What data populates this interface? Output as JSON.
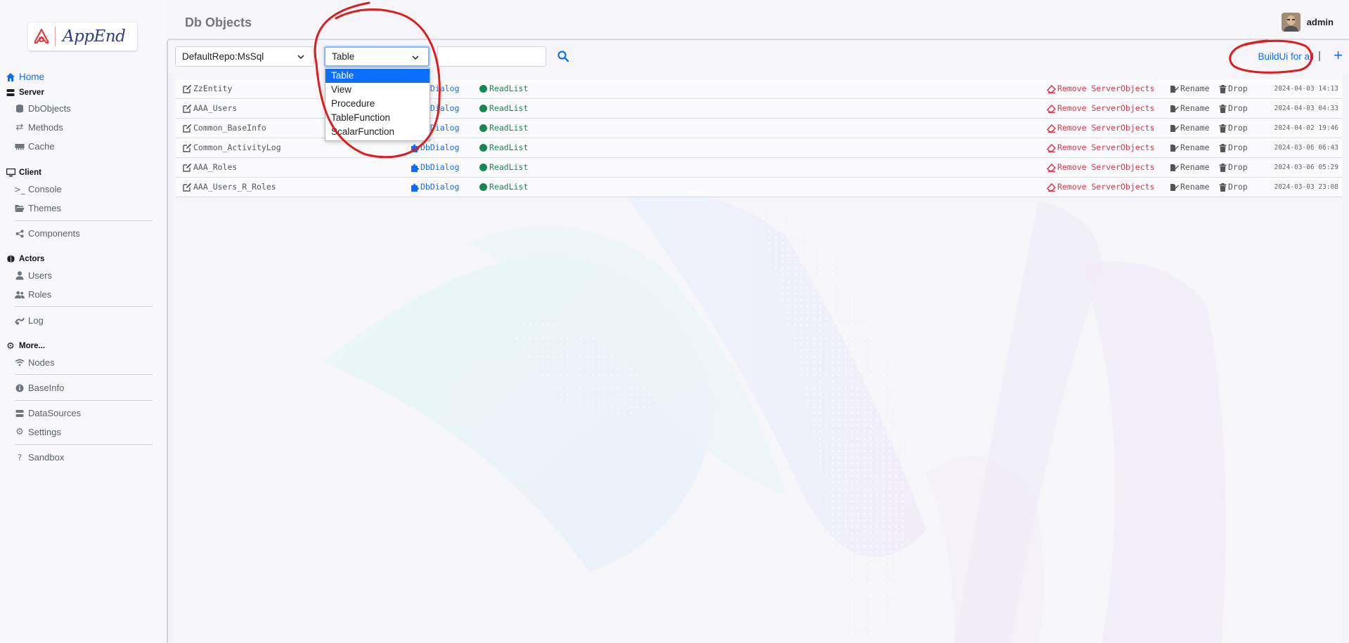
{
  "app": {
    "logo_text": "AppEnd"
  },
  "header": {
    "page_title": "Db Objects",
    "user_name": "admin"
  },
  "sidebar": {
    "home": "Home",
    "server": {
      "heading": "Server",
      "items": [
        "DbObjects",
        "Methods",
        "Cache"
      ]
    },
    "client": {
      "heading": "Client",
      "items": [
        "Console",
        "Themes",
        "Components"
      ]
    },
    "actors": {
      "heading": "Actors",
      "items": [
        "Users",
        "Roles",
        "Log"
      ]
    },
    "more": {
      "heading": "More...",
      "items": [
        "Nodes",
        "BaseInfo",
        "DataSources",
        "Settings",
        "Sandbox"
      ]
    }
  },
  "toolbar": {
    "repo_select_value": "DefaultRepo:MsSql",
    "type_select_value": "Table",
    "type_options": [
      "Table",
      "View",
      "Procedure",
      "TableFunction",
      "ScalarFunction"
    ],
    "build_ui_label": "BuildUi for all",
    "separator": "|",
    "add_label": "+"
  },
  "row_actions": {
    "dialog": "DbDialog",
    "readlist": "ReadList",
    "remove": "Remove ServerObjects",
    "rename": "Rename",
    "drop": "Drop"
  },
  "rows": [
    {
      "name": "ZzEntity",
      "date": "2024-04-03 14:13"
    },
    {
      "name": "AAA_Users",
      "date": "2024-04-03 04:33"
    },
    {
      "name": "Common_BaseInfo",
      "date": "2024-04-02 19:46"
    },
    {
      "name": "Common_ActivityLog",
      "date": "2024-03-06 06:43"
    },
    {
      "name": "AAA_Roles",
      "date": "2024-03-06 05:29"
    },
    {
      "name": "AAA_Users_R_Roles",
      "date": "2024-03-03 23:08"
    }
  ],
  "colors": {
    "primary": "#0d6efd",
    "success": "#198754",
    "danger": "#dc3545",
    "annotation": "#e01b1b"
  }
}
